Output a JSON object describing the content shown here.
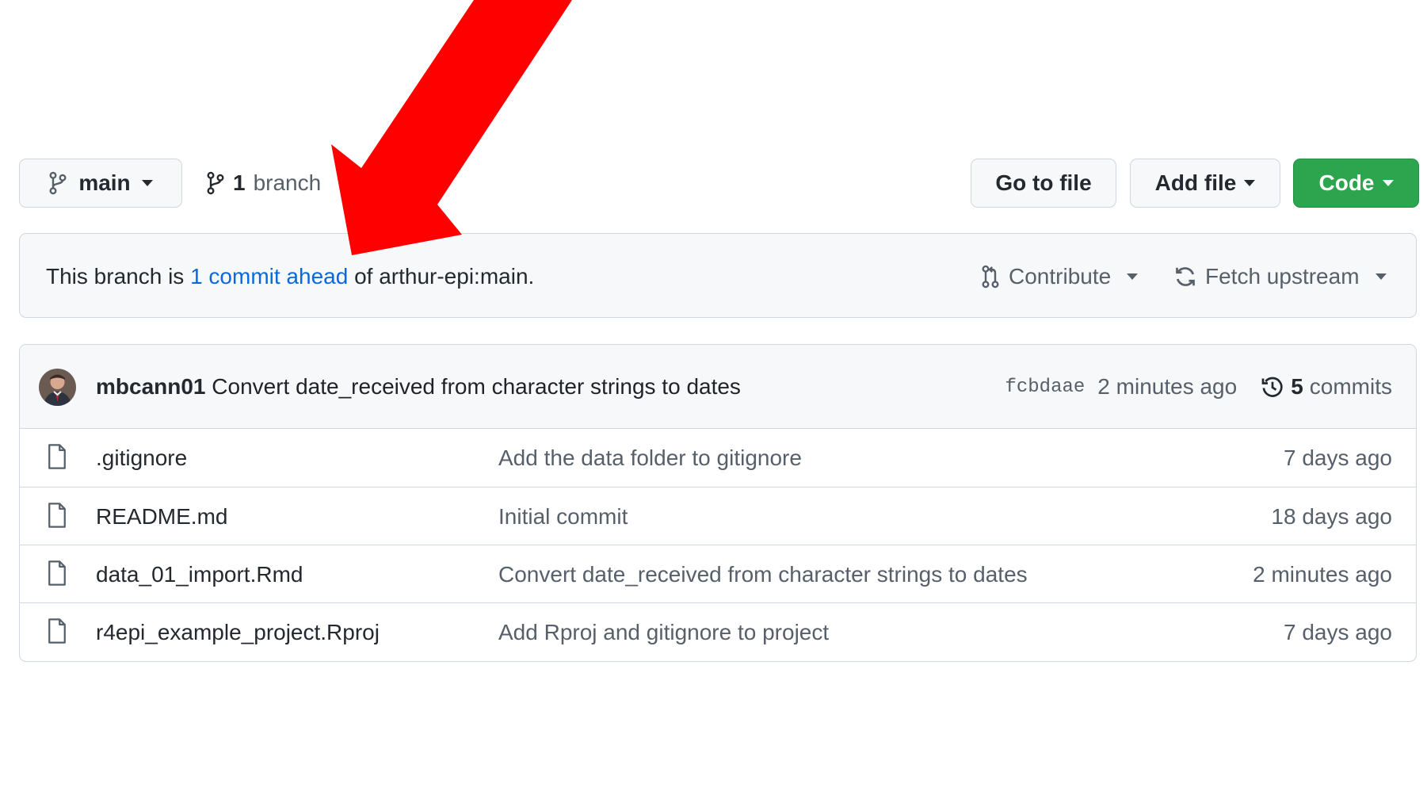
{
  "branch_selector": {
    "label": "main",
    "icon": "git-branch-icon"
  },
  "branch_count": {
    "count": "1",
    "label": "branch",
    "icon": "git-branch-icon"
  },
  "toolbar": {
    "go_to_file": "Go to file",
    "add_file": "Add file",
    "code": "Code"
  },
  "ahead_banner": {
    "prefix": "This branch is ",
    "link": "1 commit ahead",
    "suffix": " of arthur-epi:main.",
    "contribute": "Contribute",
    "fetch_upstream": "Fetch upstream"
  },
  "latest_commit": {
    "author": "mbcann01",
    "message": "Convert date_received from character strings to dates",
    "sha": "fcbdaae",
    "time": "2 minutes ago",
    "commits_count": "5",
    "commits_label": "commits"
  },
  "files": [
    {
      "name": ".gitignore",
      "commit": "Add the data folder to gitignore",
      "age": "7 days ago"
    },
    {
      "name": "README.md",
      "commit": "Initial commit",
      "age": "18 days ago"
    },
    {
      "name": "data_01_import.Rmd",
      "commit": "Convert date_received from character strings to dates",
      "age": "2 minutes ago"
    },
    {
      "name": "r4epi_example_project.Rproj",
      "commit": "Add Rproj and gitignore to project",
      "age": "7 days ago"
    }
  ],
  "colors": {
    "code_button": "#2da44e",
    "link": "#0969da",
    "annotation_arrow": "#ff0000",
    "border": "#d0d7de",
    "box_bg": "#f6f8fa"
  }
}
